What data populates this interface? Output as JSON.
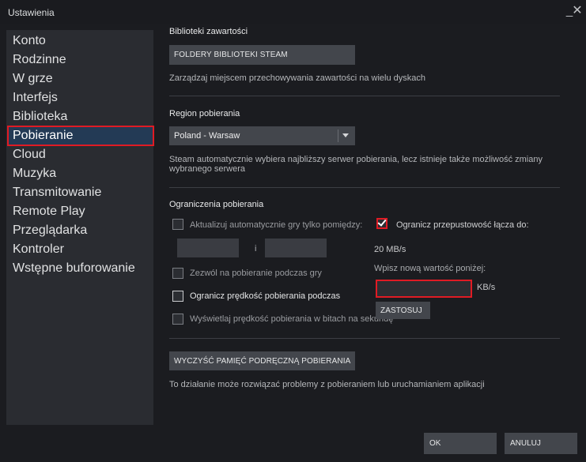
{
  "window": {
    "title": "Ustawienia",
    "minimize": "_",
    "close": "✕"
  },
  "sidebar": {
    "items": [
      {
        "label": "Konto"
      },
      {
        "label": "Rodzinne"
      },
      {
        "label": "W grze"
      },
      {
        "label": "Interfejs"
      },
      {
        "label": "Biblioteka"
      },
      {
        "label": "Pobieranie",
        "active": true
      },
      {
        "label": "Cloud"
      },
      {
        "label": "Muzyka"
      },
      {
        "label": "Transmitowanie"
      },
      {
        "label": "Remote Play"
      },
      {
        "label": "Przeglądarka"
      },
      {
        "label": "Kontroler"
      },
      {
        "label": "Wstępne buforowanie"
      }
    ]
  },
  "libraries": {
    "title": "Biblioteki zawartości",
    "button": "FOLDERY BIBLIOTEKI STEAM",
    "description": "Zarządzaj miejscem przechowywania zawartości na wielu dyskach"
  },
  "region": {
    "title": "Region pobierania",
    "selected": "Poland - Warsaw",
    "description_line1": "Steam automatycznie wybiera najbliższy serwer pobierania, lecz istnieje także możliwość zmiany",
    "description_line2": "wybranego serwera"
  },
  "limits": {
    "title": "Ograniczenia pobierania",
    "auto_update_label": "Aktualizuj automatycznie gry tylko pomiędzy:",
    "and_label": "i",
    "allow_ingame_label": "Zezwól na pobieranie podczas gry",
    "throttle_streaming_label": "Ogranicz prędkość pobierania podczas",
    "bits_label": "Wyświetlaj prędkość pobierania w bitach na sekundę",
    "bandwidth_label": "Ogranicz przepustowość łącza do:",
    "bandwidth_checked": true,
    "current_rate": "20 MB/s",
    "enter_value_label": "Wpisz nową wartość poniżej:",
    "kbs_value": "",
    "kbs_unit": "KB/s",
    "apply_button": "ZASTOSUJ"
  },
  "cache": {
    "button": "WYCZYŚĆ PAMIĘĆ PODRĘCZNĄ POBIERANIA",
    "description": "To działanie może rozwiązać problemy z pobieraniem lub uruchamianiem aplikacji"
  },
  "footer": {
    "ok": "OK",
    "cancel": "ANULUJ"
  }
}
